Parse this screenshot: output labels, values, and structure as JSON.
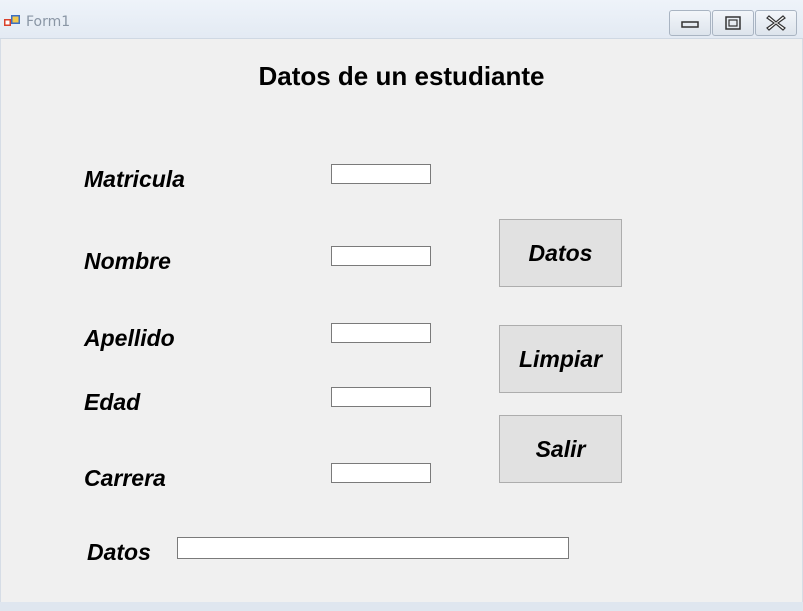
{
  "window": {
    "title": "Form1",
    "controls": {
      "minimize": "minimize-icon",
      "maximize": "maximize-icon",
      "close": "close-icon"
    }
  },
  "form": {
    "heading": "Datos de un estudiante",
    "labels": {
      "matricula": "Matricula",
      "nombre": "Nombre",
      "apellido": "Apellido",
      "edad": "Edad",
      "carrera": "Carrera",
      "datos": "Datos"
    },
    "fields": {
      "matricula": "",
      "nombre": "",
      "apellido": "",
      "edad": "",
      "carrera": "",
      "datos": ""
    },
    "buttons": {
      "datos": "Datos",
      "limpiar": "Limpiar",
      "salir": "Salir"
    }
  }
}
